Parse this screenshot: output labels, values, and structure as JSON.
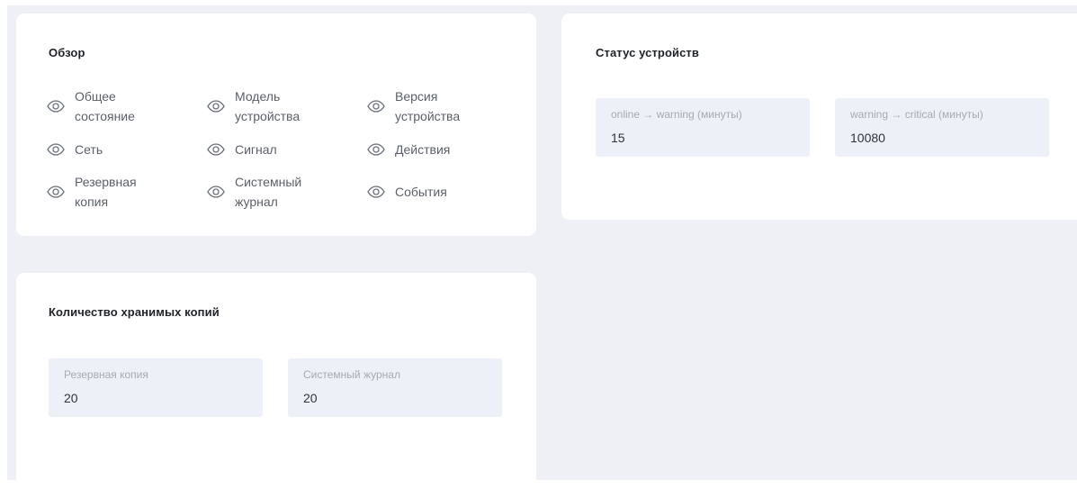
{
  "overview": {
    "title": "Обзор",
    "items": [
      {
        "label": "Общее\nсостояние",
        "icon": "eye-icon"
      },
      {
        "label": "Модель\nустройства",
        "icon": "eye-icon"
      },
      {
        "label": "Версия\nустройства",
        "icon": "eye-icon"
      },
      {
        "label": "Сеть",
        "icon": "eye-icon"
      },
      {
        "label": "Сигнал",
        "icon": "eye-icon"
      },
      {
        "label": "Действия",
        "icon": "eye-icon"
      },
      {
        "label": "Резервная\nкопия",
        "icon": "eye-icon"
      },
      {
        "label": "Системный\nжурнал",
        "icon": "eye-icon"
      },
      {
        "label": "События",
        "icon": "eye-icon"
      }
    ]
  },
  "device_status": {
    "title": "Статус устройств",
    "fields": [
      {
        "label": "online → warning (минуты)",
        "value": "15"
      },
      {
        "label": "warning → critical (минуты)",
        "value": "10080"
      }
    ]
  },
  "copies": {
    "title": "Количество хранимых копий",
    "fields": [
      {
        "label": "Резервная копия",
        "value": "20"
      },
      {
        "label": "Системный журнал",
        "value": "20"
      }
    ]
  },
  "colors": {
    "background": "#eef0f6",
    "card": "#ffffff",
    "field": "#edf0f6",
    "icon": "#6b7079"
  }
}
